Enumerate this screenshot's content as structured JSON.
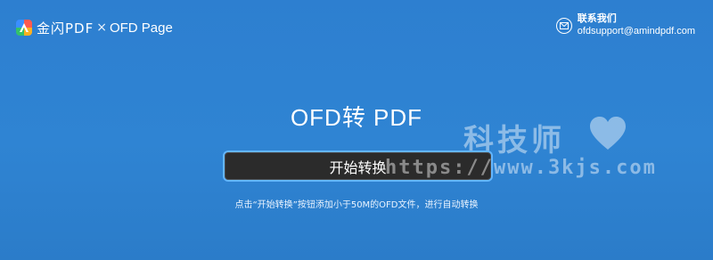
{
  "header": {
    "brand_name": "金闪PDF",
    "brand_separator": "×",
    "brand_product": "OFD Page",
    "contact_title": "联系我们",
    "contact_email": "ofdsupport@amindpdf.com"
  },
  "main": {
    "title": "OFD转 PDF",
    "start_button_label": "开始转换",
    "hint": "点击“开始转换”按钮添加小于50M的OFD文件，进行自动转换"
  },
  "watermark": {
    "text": "科技师",
    "url": "https://www.3kjs.com"
  },
  "icons": {
    "logo": "app-logo-icon",
    "mail": "mail-icon",
    "heart": "heart-icon"
  },
  "colors": {
    "background": "#2f84d3",
    "button": "#2b2b2b",
    "button_border": "#63b6ff"
  }
}
